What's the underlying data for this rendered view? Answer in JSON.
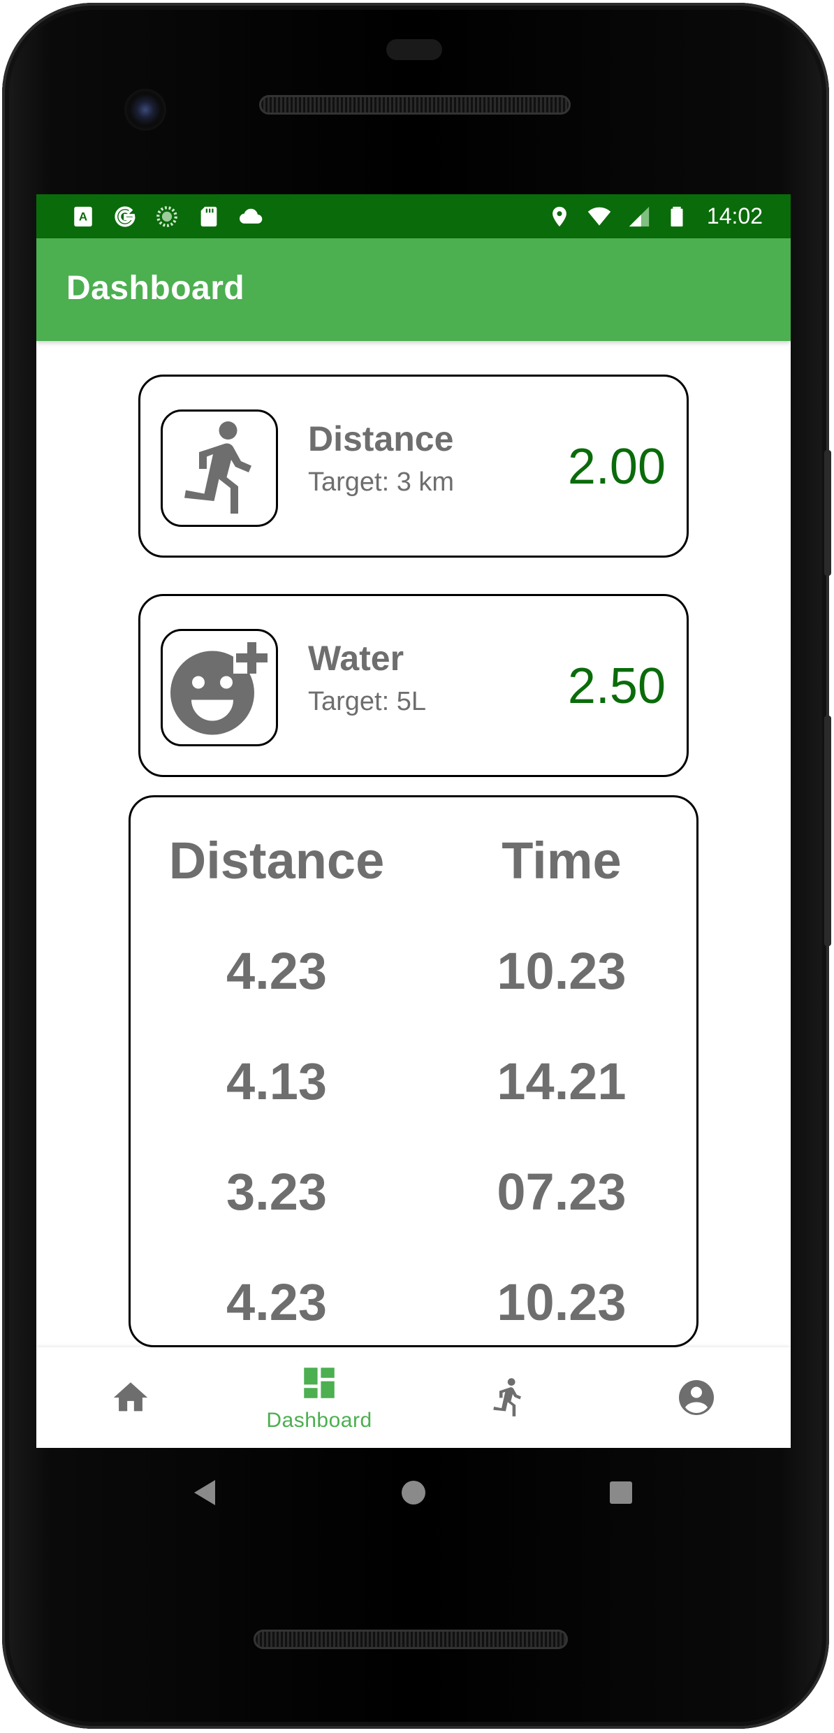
{
  "status_bar": {
    "time": "14:02",
    "left_icons": [
      "a-icon",
      "google-icon",
      "sync-icon",
      "sd-card-icon",
      "cloud-icon"
    ],
    "right_icons": [
      "location-icon",
      "wifi-icon",
      "signal-icon",
      "battery-icon"
    ]
  },
  "app_bar": {
    "title": "Dashboard"
  },
  "metrics": [
    {
      "title": "Distance",
      "target": "Target: 3 km",
      "value": "2.00",
      "icon": "run-icon"
    },
    {
      "title": "Water",
      "target": "Target: 5L",
      "value": "2.50",
      "icon": "smiley-plus-icon"
    }
  ],
  "history": {
    "headers": {
      "distance": "Distance",
      "time": "Time"
    },
    "rows": [
      {
        "distance": "4.23",
        "time": "10.23"
      },
      {
        "distance": "4.13",
        "time": "14.21"
      },
      {
        "distance": "3.23",
        "time": "07.23"
      },
      {
        "distance": "4.23",
        "time": "10.23"
      }
    ]
  },
  "bottom_nav": {
    "items": [
      {
        "icon": "home-icon",
        "label": ""
      },
      {
        "icon": "dashboard-icon",
        "label": "Dashboard",
        "active": true
      },
      {
        "icon": "run-icon",
        "label": ""
      },
      {
        "icon": "account-icon",
        "label": ""
      }
    ]
  },
  "colors": {
    "status_bar": "#0a6b0a",
    "app_bar": "#4caf50",
    "value_green": "#0a6b0a",
    "text_grey": "#6e6e6e"
  }
}
